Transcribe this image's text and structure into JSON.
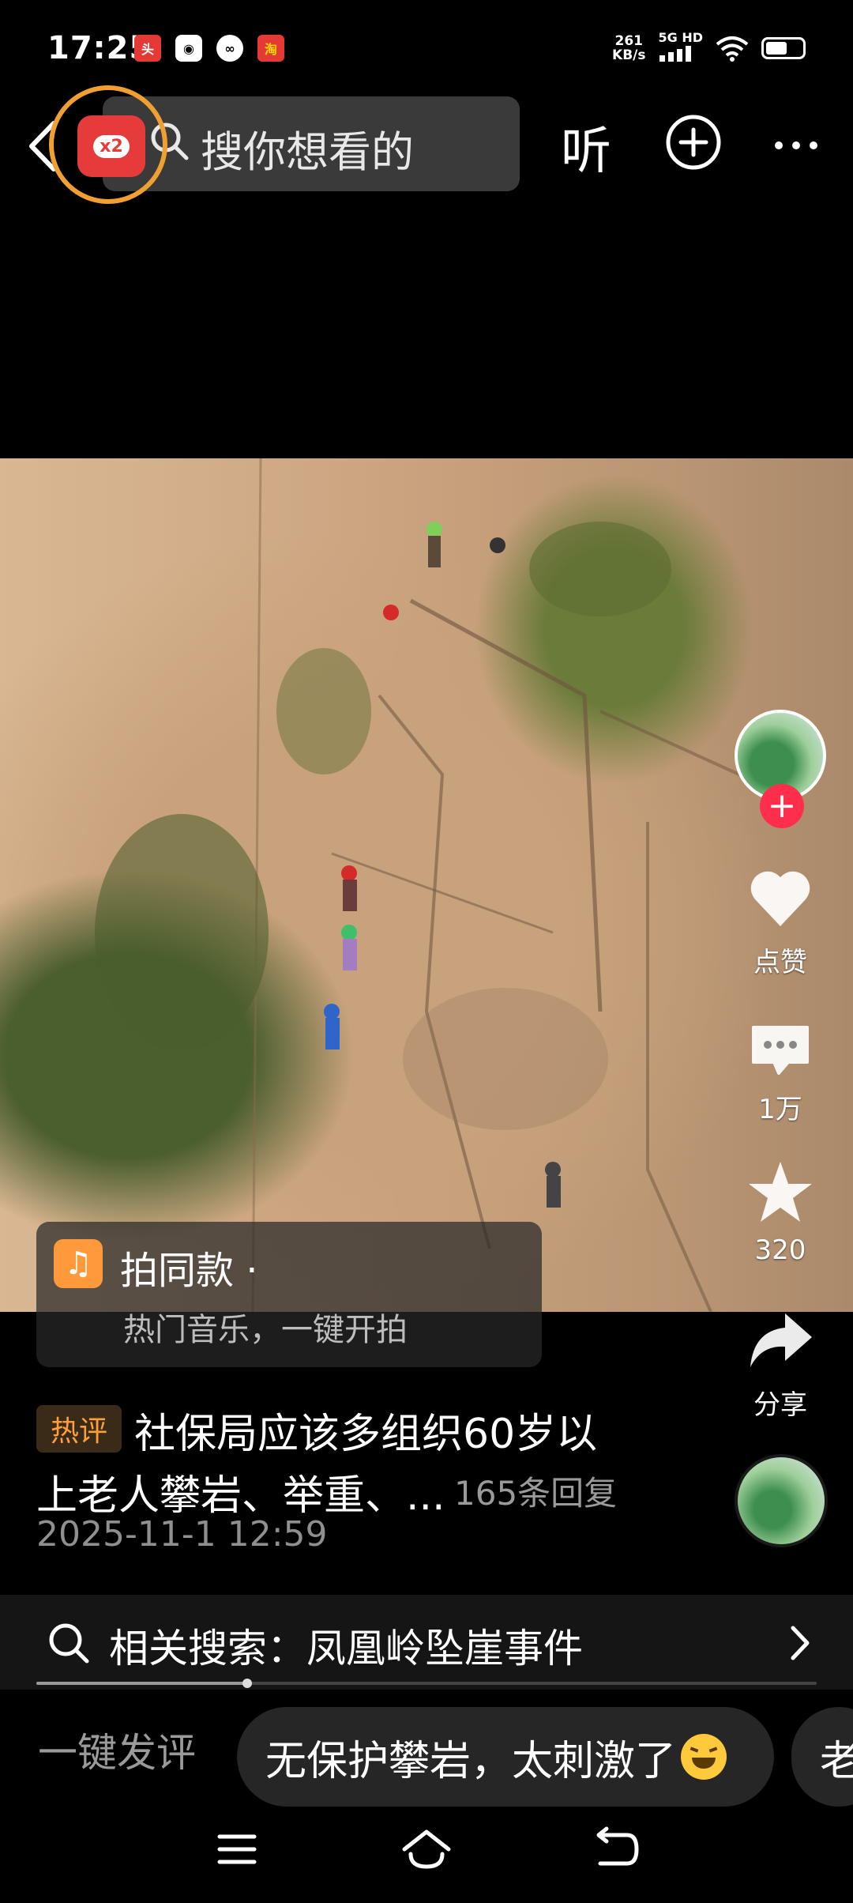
{
  "status_bar": {
    "time": "17:25",
    "net_speed_value": "261",
    "net_speed_unit": "KB/s",
    "network": "5G HD",
    "battery_level": 0.6,
    "notif_icons": [
      "toutiao-app-icon",
      "wifi-box-icon",
      "link-app-icon",
      "taobao-app-icon"
    ]
  },
  "top_bar": {
    "badge_text": "x2",
    "search_placeholder": "搜你想看的",
    "listen_label": "听"
  },
  "video": {
    "scene": "rock-climbing-cliff"
  },
  "actions": {
    "like_label": "点赞",
    "comment_count": "1万",
    "favorite_count": "320",
    "share_label": "分享"
  },
  "music_card": {
    "title": "拍同款 ·",
    "subtitle": "热门音乐，一键开拍"
  },
  "hot_comment": {
    "tag": "热评",
    "line1": "社保局应该多组织60岁以",
    "line2": "上老人攀岩、举重、...",
    "reply_count": "165条回复",
    "time": "2025-11-1 12:59"
  },
  "related_search": {
    "text": "相关搜索：凤凰岭坠崖事件",
    "progress": 0.27
  },
  "quick_comment": {
    "label": "一键发评",
    "chips": [
      "无保护攀岩，太刺激了",
      "老"
    ]
  },
  "colors": {
    "accent_red": "#ff2e4d",
    "hot_tag": "#ff9f3c",
    "badge_ring": "#f0a030"
  }
}
